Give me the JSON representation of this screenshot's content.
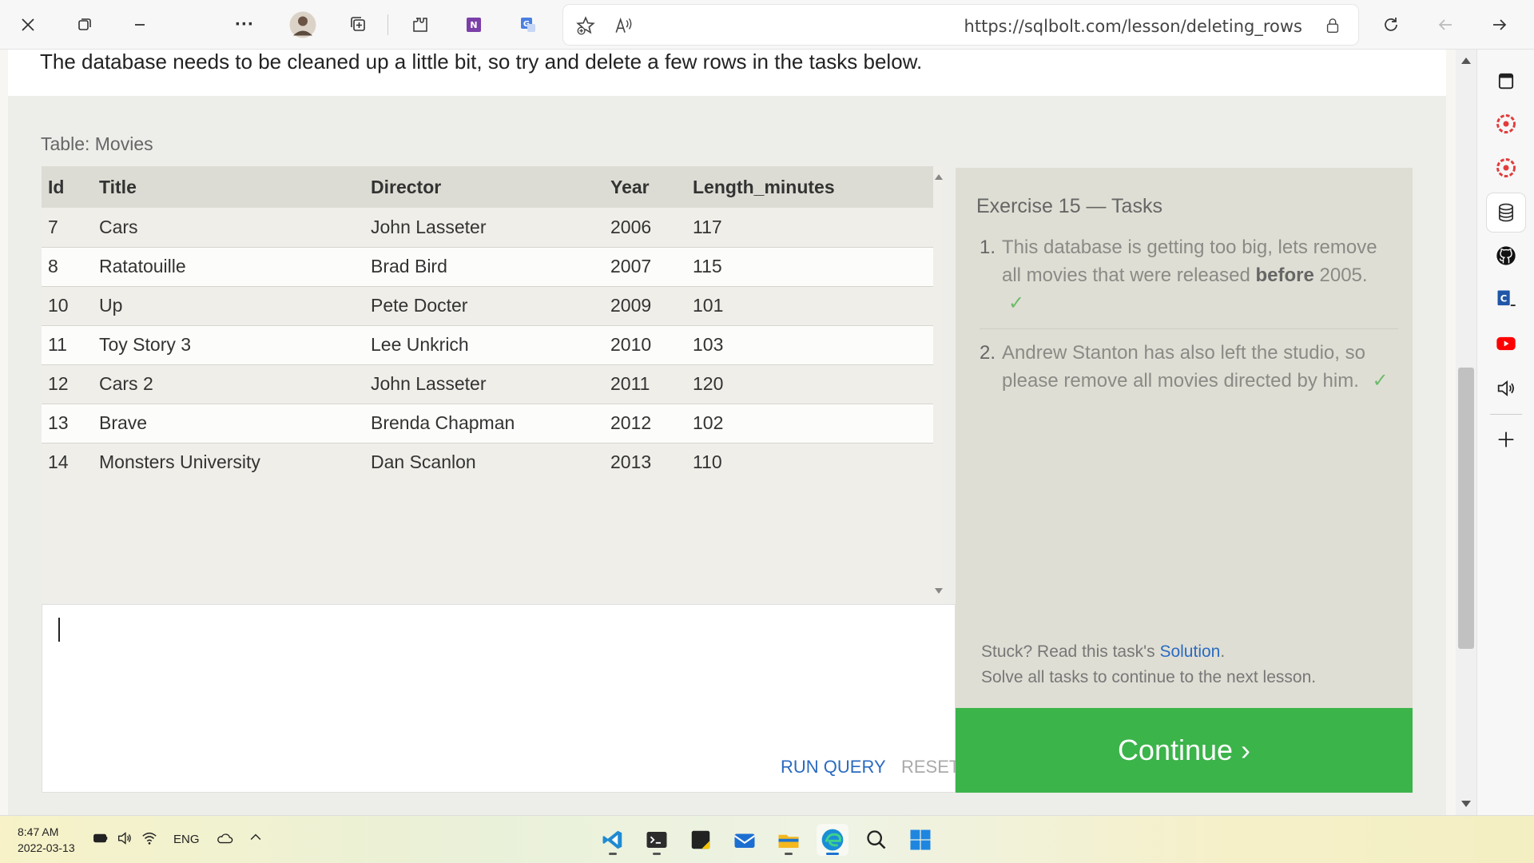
{
  "browser": {
    "url": "https://sqlbolt.com/lesson/deleting_rows",
    "more_label": "···"
  },
  "page": {
    "intro": "The database needs to be cleaned up a little bit, so try and delete a few rows in the tasks below.",
    "table_caption": "Table: Movies",
    "columns": [
      "Id",
      "Title",
      "Director",
      "Year",
      "Length_minutes"
    ],
    "rows": [
      [
        "7",
        "Cars",
        "John Lasseter",
        "2006",
        "117"
      ],
      [
        "8",
        "Ratatouille",
        "Brad Bird",
        "2007",
        "115"
      ],
      [
        "10",
        "Up",
        "Pete Docter",
        "2009",
        "101"
      ],
      [
        "11",
        "Toy Story 3",
        "Lee Unkrich",
        "2010",
        "103"
      ],
      [
        "12",
        "Cars 2",
        "John Lasseter",
        "2011",
        "120"
      ],
      [
        "13",
        "Brave",
        "Brenda Chapman",
        "2012",
        "102"
      ],
      [
        "14",
        "Monsters University",
        "Dan Scanlon",
        "2013",
        "110"
      ]
    ],
    "editor": {
      "run_query_label": "RUN QUERY",
      "reset_label": "RESET"
    }
  },
  "tasks": {
    "title": "Exercise 15 — Tasks",
    "items": [
      {
        "num": "1.",
        "text_before": "This database is getting too big, lets remove all movies that were released ",
        "bold": "before",
        "text_after": " 2005.",
        "check": "✓"
      },
      {
        "num": "2.",
        "text": "Andrew Stanton has also left the studio, so please remove all movies directed by him.",
        "check": "✓"
      }
    ],
    "stuck_prefix": "Stuck? Read this task's ",
    "solution_link": "Solution",
    "stuck_suffix": ".",
    "solve_all": "Solve all tasks to continue to the next lesson.",
    "continue_label": "Continue ›"
  },
  "taskbar": {
    "time": "8:47 AM",
    "date": "2022-03-13",
    "language": "ENG"
  },
  "colors": {
    "continue_green": "#3bb44a",
    "link_blue": "#2a6bc1",
    "check_green": "#6dbb6d"
  }
}
